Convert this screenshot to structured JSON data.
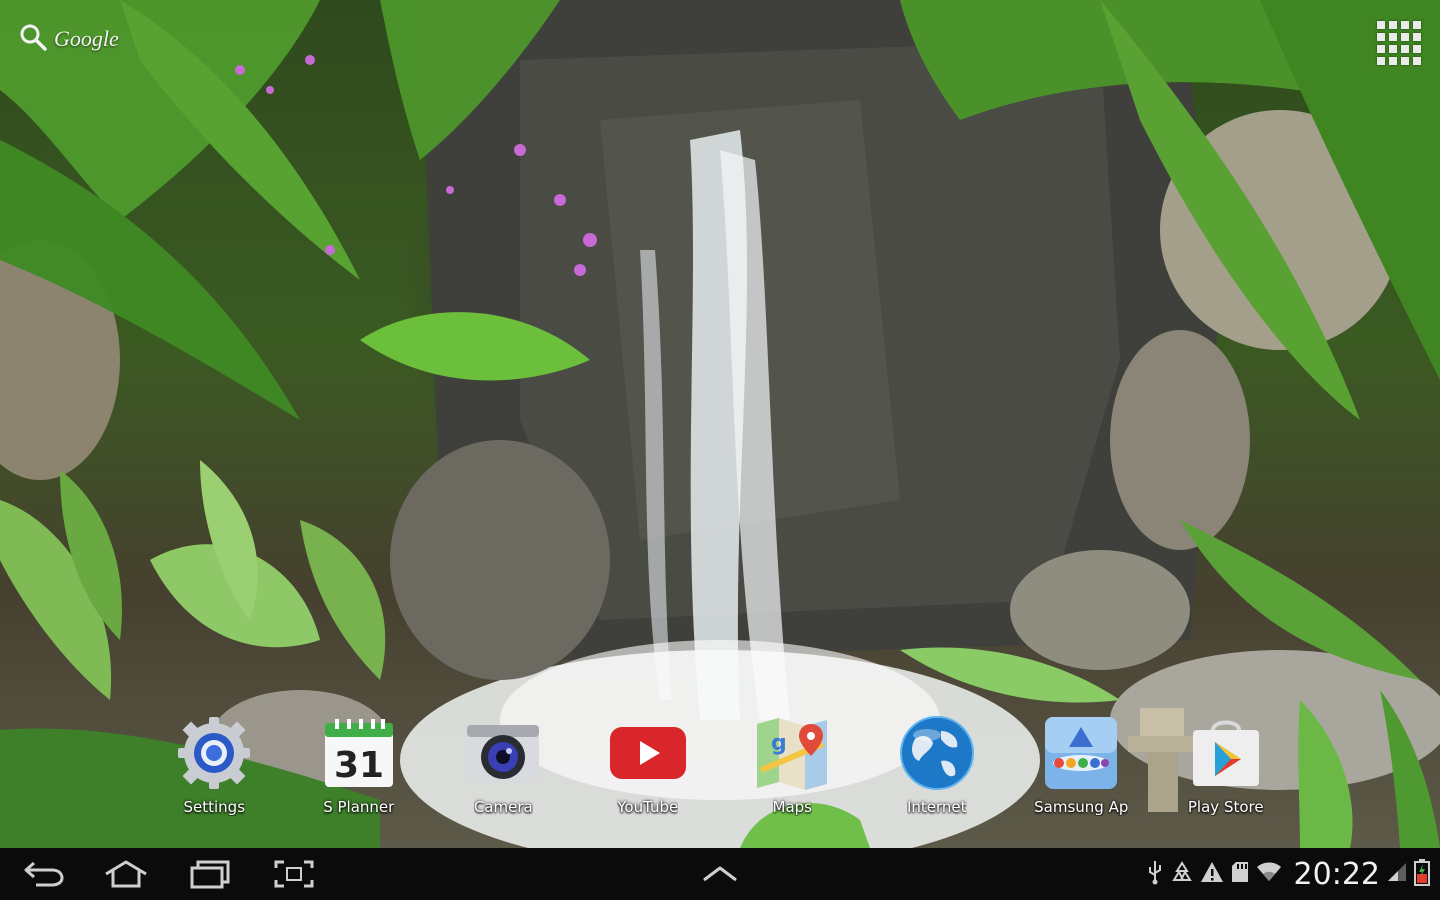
{
  "top_bar": {
    "search_label": "Google",
    "search_icon": "search-icon",
    "apps_icon": "apps-grid-icon"
  },
  "hotseat": [
    {
      "label": "Settings",
      "icon": "settings-icon"
    },
    {
      "label": "S Planner",
      "icon": "calendar-icon",
      "badge": "31"
    },
    {
      "label": "Camera",
      "icon": "camera-icon"
    },
    {
      "label": "YouTube",
      "icon": "youtube-icon"
    },
    {
      "label": "Maps",
      "icon": "maps-icon"
    },
    {
      "label": "Internet",
      "icon": "globe-icon"
    },
    {
      "label": "Samsung Ap",
      "icon": "samsung-apps-icon"
    },
    {
      "label": "Play Store",
      "icon": "play-store-icon"
    }
  ],
  "nav_bar": {
    "back": "back-icon",
    "home": "home-icon",
    "recents": "recent-apps-icon",
    "screenshot": "screenshot-icon",
    "up": "chevron-up-icon"
  },
  "status_bar": {
    "icons": [
      "usb-icon",
      "recycle-icon",
      "warning-icon",
      "sd-card-icon",
      "wifi-icon",
      "signal-icon",
      "battery-icon"
    ],
    "clock": "20:22"
  },
  "colors": {
    "nav_bg": "#0b0b0b",
    "youtube_red": "#d8262a",
    "play_green": "#3fae49",
    "battery": "#e23b2e"
  }
}
